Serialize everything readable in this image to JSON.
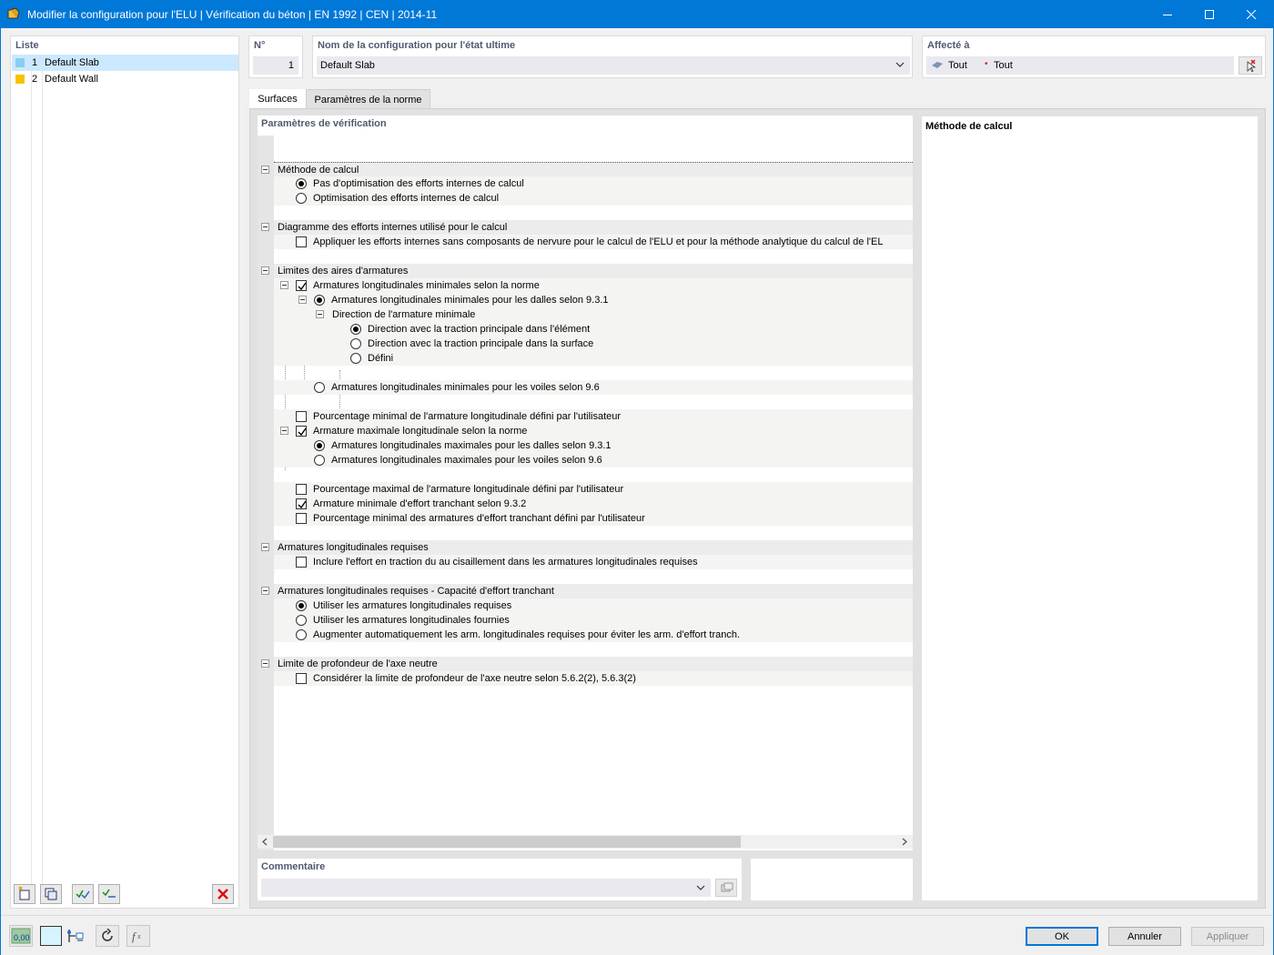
{
  "window": {
    "title": "Modifier la configuration pour l'ELU | Vérification du béton | EN 1992 | CEN | 2014-11"
  },
  "list": {
    "title": "Liste",
    "items": [
      {
        "num": "1",
        "name": "Default Slab",
        "color": "#87cef0",
        "selected": true
      },
      {
        "num": "2",
        "name": "Default Wall",
        "color": "#f5c400",
        "selected": false
      }
    ]
  },
  "header": {
    "no_label": "N°",
    "no_value": "1",
    "name_label": "Nom de la configuration pour l'état ultime",
    "name_value": "Default Slab",
    "assigned_label": "Affecté à",
    "assigned_surfaces": "Tout",
    "assigned_points": "Tout"
  },
  "tabs": [
    {
      "label": "Surfaces",
      "active": true
    },
    {
      "label": "Paramètres de la norme",
      "active": false
    }
  ],
  "tree": {
    "title": "Paramètres de vérification",
    "rows": [
      {
        "text": "Méthode de calcul"
      },
      {
        "text": "Pas d'optimisation des efforts internes de calcul"
      },
      {
        "text": "Optimisation des efforts internes de calcul"
      },
      {
        "text": "Diagramme des efforts internes utilisé pour le calcul"
      },
      {
        "text": "Appliquer les efforts internes sans composants de nervure pour le calcul de l'ELU et pour la méthode analytique du calcul de l'EL"
      },
      {
        "text": "Limites des aires d'armatures"
      },
      {
        "text": "Armatures longitudinales minimales selon la norme"
      },
      {
        "text": "Armatures longitudinales minimales pour les dalles selon 9.3.1"
      },
      {
        "text": "Direction de l'armature minimale"
      },
      {
        "text": "Direction avec la traction principale dans l'élément"
      },
      {
        "text": "Direction avec la traction principale dans la surface"
      },
      {
        "text": "Défini"
      },
      {
        "text": "Armatures longitudinales minimales pour les voiles selon 9.6"
      },
      {
        "text": "Pourcentage minimal de l'armature longitudinale défini par l'utilisateur"
      },
      {
        "text": "Armature maximale longitudinale selon la norme"
      },
      {
        "text": "Armatures longitudinales maximales pour les dalles selon 9.3.1"
      },
      {
        "text": "Armatures longitudinales maximales pour les voiles selon 9.6"
      },
      {
        "text": "Pourcentage maximal de l'armature longitudinale défini par l'utilisateur"
      },
      {
        "text": "Armature minimale d'effort tranchant selon 9.3.2"
      },
      {
        "text": "Pourcentage minimal des armatures d'effort tranchant défini par l'utilisateur"
      },
      {
        "text": "Armatures longitudinales requises"
      },
      {
        "text": "Inclure l'effort en traction du au cisaillement dans les armatures longitudinales requises"
      },
      {
        "text": "Armatures longitudinales requises - Capacité d'effort tranchant"
      },
      {
        "text": "Utiliser les armatures longitudinales requises"
      },
      {
        "text": "Utiliser les armatures longitudinales fournies"
      },
      {
        "text": "Augmenter automatiquement les arm. longitudinales requises pour éviter les arm. d'effort tranch."
      },
      {
        "text": "Limite de profondeur de l'axe neutre"
      },
      {
        "text": "Considérer la limite de profondeur de l'axe neutre selon 5.6.2(2), 5.6.3(2)"
      }
    ]
  },
  "description": {
    "title": "Méthode de calcul"
  },
  "comment": {
    "label": "Commentaire",
    "value": ""
  },
  "buttons": {
    "ok": "OK",
    "cancel": "Annuler",
    "apply": "Appliquer"
  },
  "units_icon_text": "0,00"
}
